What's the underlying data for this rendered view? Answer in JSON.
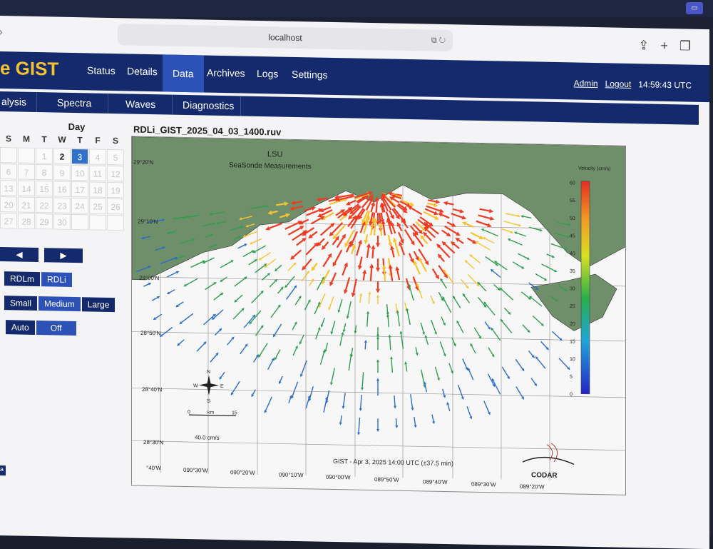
{
  "browser": {
    "url": "localhost",
    "share_icon": "share-icon",
    "new_tab_icon": "plus-icon",
    "tabs_icon": "tabs-icon"
  },
  "app": {
    "brand": "e GIST",
    "nav": [
      "Status",
      "Details",
      "Data",
      "Archives",
      "Logs",
      "Settings"
    ],
    "active_nav": "Data",
    "user": {
      "admin": "Admin",
      "logout": "Logout",
      "clock": "14:59:43 UTC"
    },
    "subnav": [
      "alysis",
      "Spectra",
      "Waves",
      "Diagnostics"
    ]
  },
  "calendar": {
    "title": "Day",
    "weekdays": [
      "S",
      "M",
      "T",
      "W",
      "T",
      "F",
      "S"
    ],
    "weeks": [
      [
        "",
        "",
        "1",
        "2",
        "3",
        "4",
        "5"
      ],
      [
        "6",
        "7",
        "8",
        "9",
        "10",
        "11",
        "12"
      ],
      [
        "13",
        "14",
        "15",
        "16",
        "17",
        "18",
        "19"
      ],
      [
        "20",
        "21",
        "22",
        "23",
        "24",
        "25",
        "26"
      ],
      [
        "27",
        "28",
        "29",
        "30",
        "",
        "",
        ""
      ]
    ],
    "selected": "3"
  },
  "controls": {
    "prev_icon": "left-arrow-icon",
    "next_icon": "right-arrow-icon",
    "type_options": [
      "RDLm",
      "RDLi"
    ],
    "type_selected": "RDLi",
    "size_options": [
      "Small",
      "Medium",
      "Large"
    ],
    "size_selected": "Medium",
    "auto_options": [
      "Auto",
      "Off"
    ],
    "auto_selected": "Off"
  },
  "map": {
    "file_title": "RDLi_GIST_2025_04_03_1400.ruv",
    "station_label": "LSU",
    "station_sub": "SeaSonde Measurements",
    "lat_labels": [
      "29°20'N",
      "29°10'N",
      "29°00'N",
      "28°50'N",
      "28°40'N",
      "28°30'N"
    ],
    "lon_labels": [
      "°40'W",
      "090°30'W",
      "090°20'W",
      "090°10'W",
      "090°00'W",
      "089°50'W",
      "089°40'W",
      "089°30'W",
      "089°20'W"
    ],
    "scale_bar": {
      "start": "0",
      "unit": "km",
      "end": "15"
    },
    "reference_vector": "40.0 cm/s",
    "timestamp": "GIST - Apr 3, 2025 14:00 UTC (±37.5 min)",
    "logo_text": "CODAR",
    "compass": {
      "n": "N",
      "s": "S",
      "e": "E",
      "w": "W"
    },
    "colorbar": {
      "title": "Velocity (cm/s)",
      "ticks": [
        "60",
        "55",
        "50",
        "45",
        "40",
        "35",
        "30",
        "25",
        "20",
        "15",
        "10",
        "5",
        "0"
      ]
    },
    "colors": {
      "land": "#6f8f6a",
      "water": "#f7f7f7",
      "fast": "#ee3b22",
      "mid": "#f7c430",
      "slow": "#2f9e4f",
      "low": "#2a6cc9"
    }
  }
}
